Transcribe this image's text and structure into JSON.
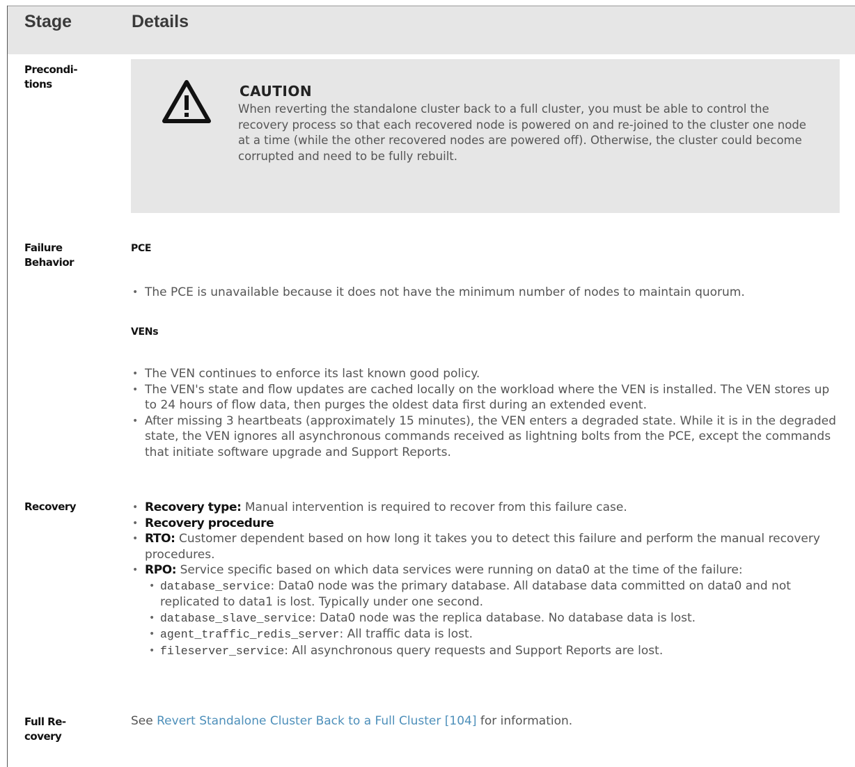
{
  "header": {
    "stage": "Stage",
    "details": "Details"
  },
  "stages": {
    "preconditions": [
      "Precondi-",
      "tions"
    ],
    "failure": [
      "Failure",
      "Behavior"
    ],
    "recovery": [
      "Recovery"
    ],
    "full_recovery": [
      "Full Re-",
      "covery"
    ]
  },
  "caution": {
    "title": "CAUTION",
    "text": "When reverting the standalone cluster back to a full cluster, you must be able to control the recovery process so that each recovered node is powered on and re-joined to the cluster one node at a time (while the other recovered nodes are powered off). Otherwise, the cluster could become corrupted and need to be fully rebuilt."
  },
  "failure": {
    "pce_heading": "PCE",
    "pce_items": [
      "The PCE is unavailable because it does not have the minimum number of nodes to maintain quorum."
    ],
    "vens_heading": "VENs",
    "ven_items": [
      "The VEN continues to enforce its last known good policy.",
      "The VEN's state and flow updates are cached locally on the workload where the VEN is installed. The VEN stores up to 24 hours of flow data, then purges the oldest data first during an extended event.",
      "After missing 3 heartbeats (approximately 15 minutes), the VEN enters a degraded state. While it is in the degraded state, the VEN ignores all asynchronous commands received as lightning bolts from the PCE, except the commands that initiate software upgrade and Support Reports."
    ]
  },
  "recovery": {
    "type_label": "Recovery type:",
    "type_text": " Manual intervention is required to recover from this failure case.",
    "procedure_label": "Recovery procedure",
    "rto_label": "RTO:",
    "rto_text": " Customer dependent based on how long it takes you to detect this failure and perform the manual recovery procedures.",
    "rpo_label": "RPO:",
    "rpo_text": " Service specific based on which data services were running on data0 at the time of the failure:",
    "services": [
      {
        "name": "database_service",
        "text": ": Data0 node was the primary database. All database data committed on data0 and not replicated to data1 is lost. Typically under one second."
      },
      {
        "name": "database_slave_service",
        "text": ": Data0 node was the replica database. No database data is lost."
      },
      {
        "name": "agent_traffic_redis_server",
        "text": ": All traffic data is lost."
      },
      {
        "name": "fileserver_service",
        "text": ": All asynchronous query requests and Support Reports are lost."
      }
    ]
  },
  "full_recovery": {
    "prefix": "See ",
    "link_text": "Revert Standalone Cluster Back to a Full Cluster [104]",
    "suffix": " for information."
  }
}
